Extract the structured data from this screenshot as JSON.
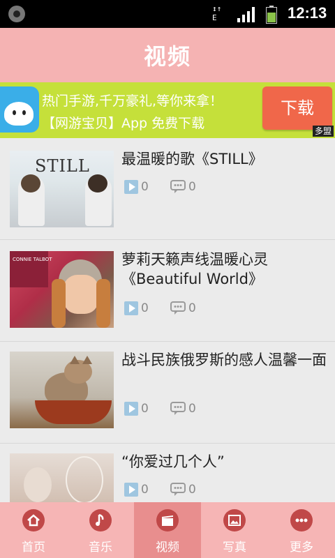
{
  "status_bar": {
    "network_label": "3G\nE",
    "time": "12:13"
  },
  "header": {
    "title": "视频"
  },
  "ad_banner": {
    "line1": "热门手游,千万豪礼,等你来拿！",
    "line2": "【网游宝贝】App  免费下载",
    "button_label": "下载",
    "tag": "多盟"
  },
  "videos": [
    {
      "title": "最温暖的歌《STILL》",
      "plays": "0",
      "comments": "0",
      "thumb_text": "STILL"
    },
    {
      "title": "萝莉天籁声线温暖心灵《Beautiful World》",
      "plays": "0",
      "comments": "0",
      "thumb_text": "CONNIE TALBOT"
    },
    {
      "title": "战斗民族俄罗斯的感人温馨一面",
      "plays": "0",
      "comments": "0",
      "thumb_text": ""
    },
    {
      "title": "“你爱过几个人”",
      "plays": "0",
      "comments": "0",
      "thumb_text": ""
    }
  ],
  "tabs": [
    {
      "label": "首页",
      "icon": "home-icon"
    },
    {
      "label": "音乐",
      "icon": "music-note-icon"
    },
    {
      "label": "视频",
      "icon": "clapperboard-icon",
      "active": true
    },
    {
      "label": "写真",
      "icon": "image-icon"
    },
    {
      "label": "更多",
      "icon": "more-dots-icon"
    }
  ],
  "colors": {
    "header_bg": "#f5b3b3",
    "ad_bg": "#c5e03a",
    "ad_button": "#f0674a",
    "tab_active": "#e88e8e",
    "tab_icon": "#c04848"
  }
}
